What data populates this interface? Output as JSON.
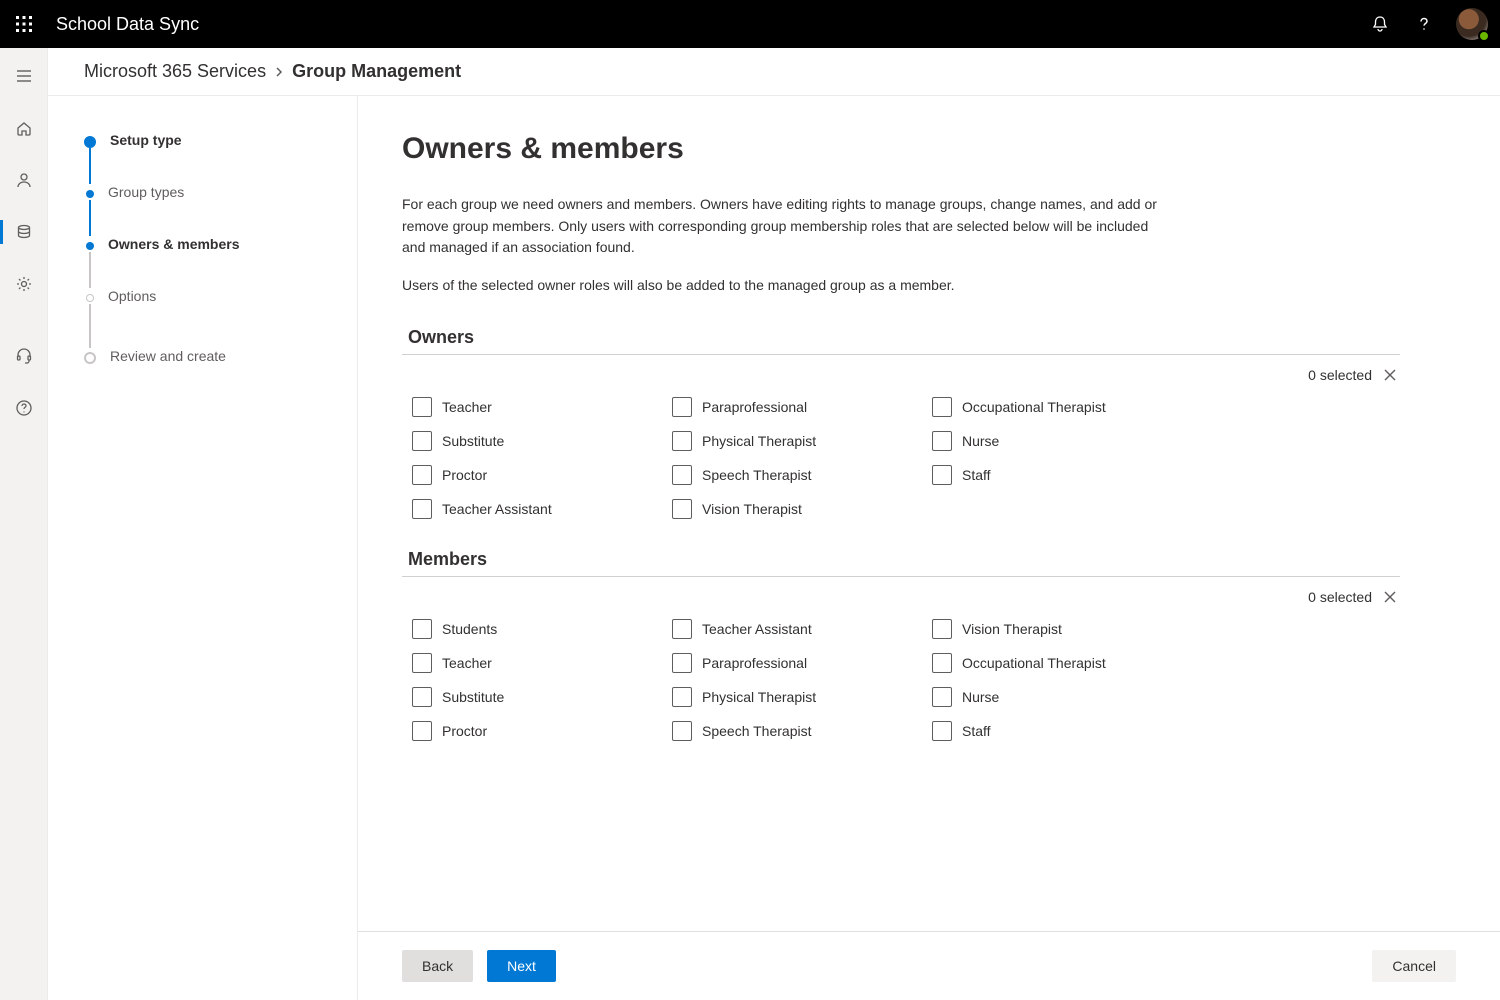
{
  "header": {
    "app_title": "School Data Sync"
  },
  "breadcrumb": {
    "root": "Microsoft 365 Services",
    "current": "Group Management"
  },
  "steps": [
    {
      "label": "Setup type",
      "state": "done-primary"
    },
    {
      "label": "Group types",
      "state": "done"
    },
    {
      "label": "Owners & members",
      "state": "current"
    },
    {
      "label": "Options",
      "state": "upcoming"
    },
    {
      "label": "Review and create",
      "state": "final"
    }
  ],
  "page": {
    "heading": "Owners & members",
    "intro1": "For each group we need owners and members. Owners have editing rights to manage groups, change names, and add or remove group members. Only users with corresponding group membership roles that are selected below will be included and managed if an association found.",
    "intro2": "Users of the selected owner roles will also be added to the managed group as a member."
  },
  "owners": {
    "heading": "Owners",
    "selected_text": "0 selected",
    "items": [
      "Teacher",
      "Paraprofessional",
      "Occupational Therapist",
      "Substitute",
      "Physical Therapist",
      "Nurse",
      "Proctor",
      "Speech Therapist",
      "Staff",
      "Teacher Assistant",
      "Vision Therapist"
    ]
  },
  "members": {
    "heading": "Members",
    "selected_text": "0 selected",
    "items": [
      "Students",
      "Teacher Assistant",
      "Vision Therapist",
      "Teacher",
      "Paraprofessional",
      "Occupational Therapist",
      "Substitute",
      "Physical Therapist",
      "Nurse",
      "Proctor",
      "Speech Therapist",
      "Staff"
    ]
  },
  "footer": {
    "back": "Back",
    "next": "Next",
    "cancel": "Cancel"
  }
}
